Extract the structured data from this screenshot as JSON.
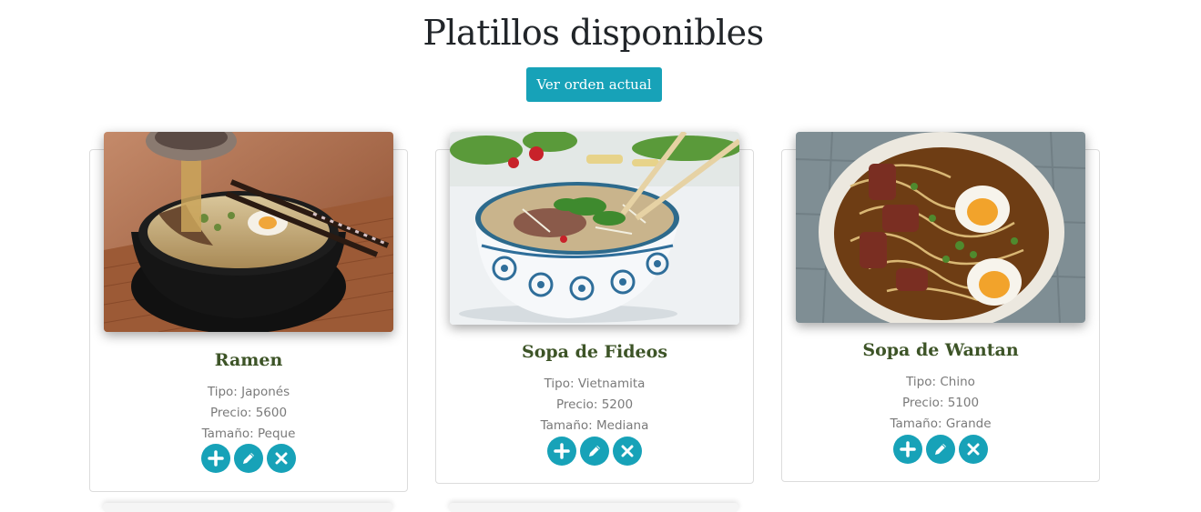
{
  "header": {
    "title": "Platillos disponibles",
    "order_button_label": "Ver orden actual"
  },
  "colors": {
    "accent": "#17a2b8",
    "title_text": "#3d5427",
    "meta_text": "#7a7a7a"
  },
  "dishes": [
    {
      "name": "Ramen",
      "tipo": "Tipo: Japonés",
      "precio": "Precio: 5600",
      "tamano": "Tamaño: Peque",
      "image": "ramen-photo"
    },
    {
      "name": "Sopa de Fideos",
      "tipo": "Tipo: Vietnamita",
      "precio": "Precio: 5200",
      "tamano": "Tamaño: Mediana",
      "image": "pho-photo"
    },
    {
      "name": "Sopa de Wantan",
      "tipo": "Tipo: Chino",
      "precio": "Precio: 5100",
      "tamano": "Tamaño: Grande",
      "image": "wantan-soup-photo"
    }
  ],
  "actions": {
    "add_icon": "plus-icon",
    "edit_icon": "pencil-icon",
    "delete_icon": "close-icon"
  }
}
